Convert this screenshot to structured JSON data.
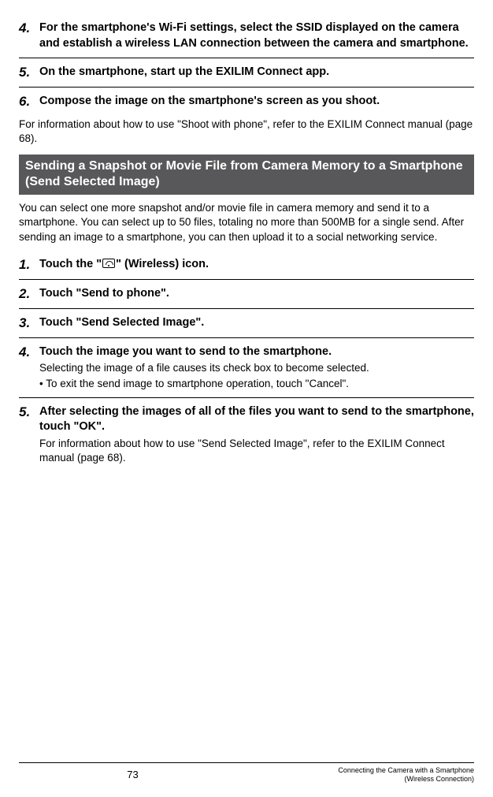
{
  "topSteps": [
    {
      "num": "4.",
      "title": "For the smartphone's Wi-Fi settings, select the SSID displayed on the camera and establish a wireless LAN connection between the camera and smartphone."
    },
    {
      "num": "5.",
      "title": "On the smartphone, start up the EXILIM Connect app."
    },
    {
      "num": "6.",
      "title": "Compose the image on the smartphone's screen as you shoot."
    }
  ],
  "topNote": "For information about how to use \"Shoot with phone\", refer to the EXILIM Connect manual (page 68).",
  "sectionTitle": "Sending a Snapshot or Movie File from Camera Memory to a Smartphone (Send Selected Image)",
  "intro": "You can select one more snapshot and/or movie file in camera memory and send it to a smartphone. You can select up to 50 files, totaling no more than 500MB for a single send. After sending an image to a smartphone, you can then upload it to a social networking service.",
  "steps": [
    {
      "num": "1.",
      "titlePre": "Touch the \"",
      "titlePost": "\" (Wireless) icon."
    },
    {
      "num": "2.",
      "title": "Touch \"Send to phone\"."
    },
    {
      "num": "3.",
      "title": "Touch \"Send Selected Image\"."
    },
    {
      "num": "4.",
      "title": "Touch the image you want to send to the smartphone.",
      "sub": "Selecting the image of a file causes its check box to become selected.",
      "bullet": "• To exit the send image to smartphone operation, touch \"Cancel\"."
    },
    {
      "num": "5.",
      "title": "After selecting the images of all of the files you want to send to the smartphone, touch \"OK\".",
      "sub": "For information about how to use \"Send Selected Image\", refer to the EXILIM Connect manual (page 68)."
    }
  ],
  "footer": {
    "page": "73",
    "line1": "Connecting the Camera with a Smartphone",
    "line2": "(Wireless Connection)"
  }
}
